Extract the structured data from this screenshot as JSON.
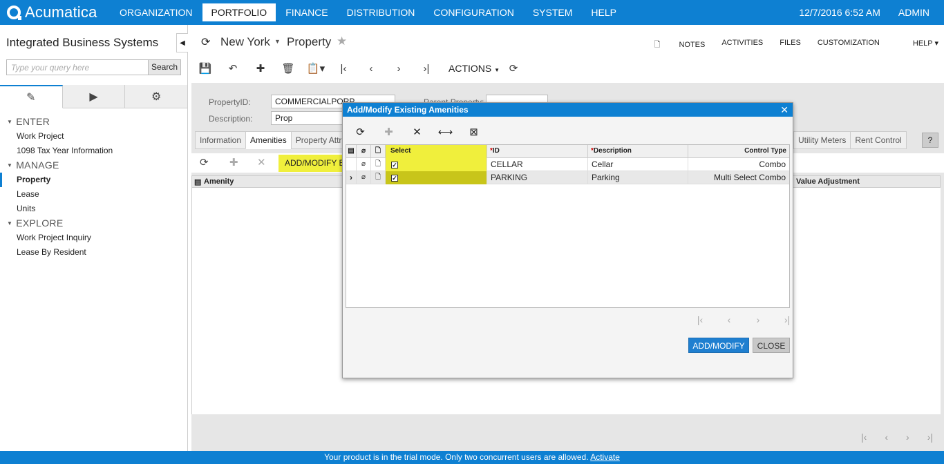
{
  "app": {
    "logo_text": "Acumatica",
    "nav": [
      "ORGANIZATION",
      "PORTFOLIO",
      "FINANCE",
      "DISTRIBUTION",
      "CONFIGURATION",
      "SYSTEM",
      "HELP"
    ],
    "active_nav": "PORTFOLIO",
    "datetime": "12/7/2016  6:52 AM",
    "user": "ADMIN"
  },
  "sidebar": {
    "company": "Integrated Business Systems",
    "search_placeholder": "Type your query here",
    "search_button": "Search",
    "groups": [
      {
        "label": "ENTER",
        "items": [
          "Work Project",
          "1098 Tax Year Information"
        ]
      },
      {
        "label": "MANAGE",
        "items": [
          "Property",
          "Lease",
          "Units"
        ]
      },
      {
        "label": "EXPLORE",
        "items": [
          "Work Project Inquiry",
          "Lease By Resident"
        ]
      }
    ],
    "active_item": "Property"
  },
  "screen": {
    "location": "New York",
    "title": "Property",
    "links": [
      "NOTES",
      "ACTIVITIES",
      "FILES",
      "CUSTOMIZATION",
      "HELP"
    ],
    "actions_label": "ACTIONS",
    "form": {
      "property_id_label": "PropertyID:",
      "property_id_value": "COMMERCIALPORP",
      "parent_property_label": "Parent Property:",
      "description_label": "Description:",
      "description_value": "Prop"
    },
    "tabs": [
      "Information",
      "Amenities",
      "Property Attri"
    ],
    "tabs_right": [
      "Utility Meters",
      "Rent Control"
    ],
    "active_tab": "Amenities",
    "grid_button": "ADD/MODIFY E",
    "grid_columns": {
      "amenity": "Amenity",
      "value_adjustment": "Value Adjustment"
    }
  },
  "dialog": {
    "title": "Add/Modify Existing Amenities",
    "columns": {
      "select": "Select",
      "id": "ID",
      "description": "Description",
      "control_type": "Control Type"
    },
    "rows": [
      {
        "selected": true,
        "id": "CELLAR",
        "description": "Cellar",
        "control_type": "Combo"
      },
      {
        "selected": true,
        "id": "PARKING",
        "description": "Parking",
        "control_type": "Multi Select Combo"
      }
    ],
    "add_button": "ADD/MODIFY",
    "close_button": "CLOSE"
  },
  "footer": {
    "message": "Your product is in the trial mode. Only two concurrent users are allowed.",
    "link": "Activate"
  },
  "colors": {
    "brand": "#0e80d2",
    "highlight": "#f0ef3c",
    "highlight_dark": "#c8c51a"
  }
}
